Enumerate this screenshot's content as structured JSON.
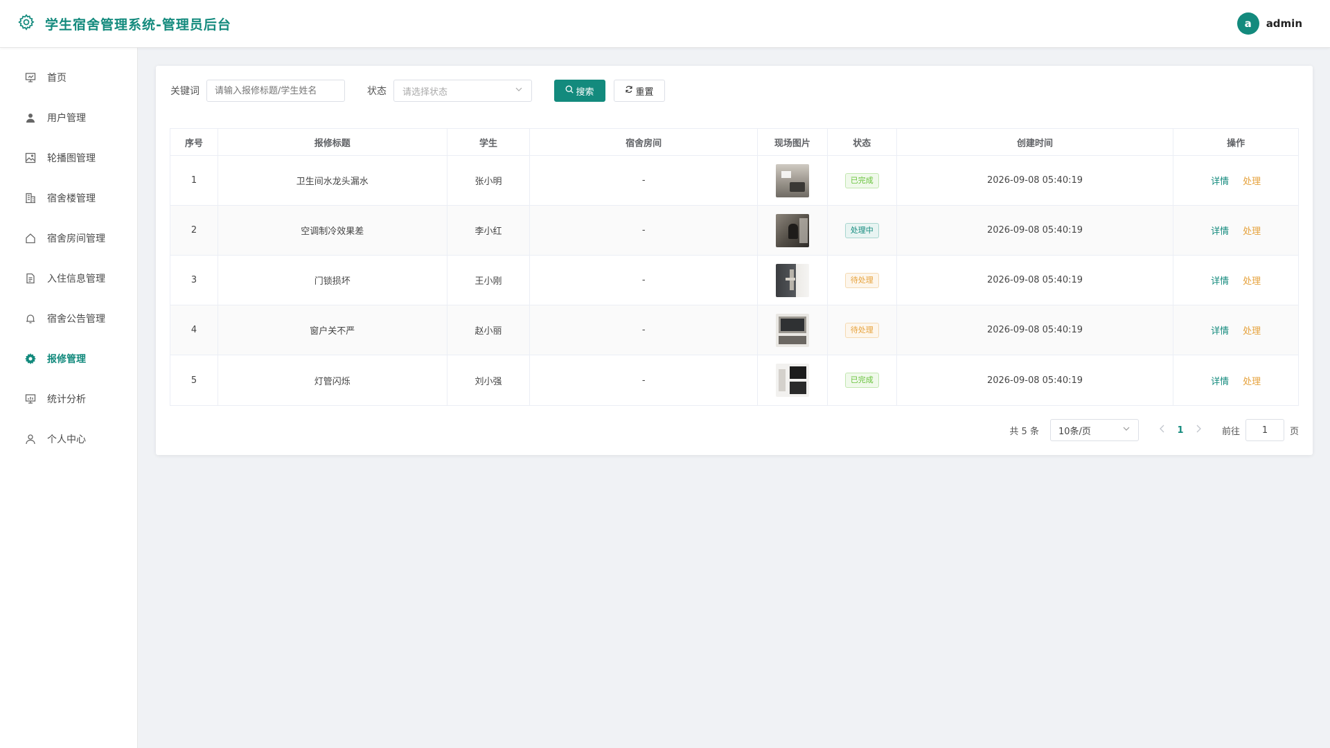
{
  "header": {
    "title": "学生宿舍管理系统-管理员后台",
    "avatar_letter": "a",
    "username": "admin"
  },
  "sidebar": {
    "items": [
      {
        "label": "首页",
        "icon": "dashboard-icon"
      },
      {
        "label": "用户管理",
        "icon": "user-icon"
      },
      {
        "label": "轮播图管理",
        "icon": "image-icon"
      },
      {
        "label": "宿舍楼管理",
        "icon": "building-icon"
      },
      {
        "label": "宿舍房间管理",
        "icon": "home-icon"
      },
      {
        "label": "入住信息管理",
        "icon": "document-icon"
      },
      {
        "label": "宿舍公告管理",
        "icon": "bell-icon"
      },
      {
        "label": "报修管理",
        "icon": "gear-icon",
        "active": true
      },
      {
        "label": "统计分析",
        "icon": "chart-icon"
      },
      {
        "label": "个人中心",
        "icon": "person-icon"
      }
    ]
  },
  "filters": {
    "keyword_label": "关键词",
    "keyword_placeholder": "请输入报修标题/学生姓名",
    "status_label": "状态",
    "status_placeholder": "请选择状态",
    "search_label": "搜索",
    "reset_label": "重置"
  },
  "table": {
    "columns": [
      "序号",
      "报修标题",
      "学生",
      "宿舍房间",
      "现场图片",
      "状态",
      "创建时间",
      "操作"
    ],
    "rows": [
      {
        "index": "1",
        "title": "卫生间水龙头漏水",
        "student": "张小明",
        "room": "-",
        "status": "已完成",
        "status_type": "done",
        "created": "2026-09-08 05:40:19"
      },
      {
        "index": "2",
        "title": "空调制冷效果差",
        "student": "李小红",
        "room": "-",
        "status": "处理中",
        "status_type": "doing",
        "created": "2026-09-08 05:40:19"
      },
      {
        "index": "3",
        "title": "门锁损坏",
        "student": "王小刚",
        "room": "-",
        "status": "待处理",
        "status_type": "todo",
        "created": "2026-09-08 05:40:19"
      },
      {
        "index": "4",
        "title": "窗户关不严",
        "student": "赵小丽",
        "room": "-",
        "status": "待处理",
        "status_type": "todo",
        "created": "2026-09-08 05:40:19"
      },
      {
        "index": "5",
        "title": "灯管闪烁",
        "student": "刘小强",
        "room": "-",
        "status": "已完成",
        "status_type": "done",
        "created": "2026-09-08 05:40:19"
      }
    ],
    "detail_label": "详情",
    "handle_label": "处理"
  },
  "pagination": {
    "total_text": "共 5 条",
    "page_size": "10条/页",
    "current_page": "1",
    "goto_label": "前往",
    "goto_value": "1",
    "page_suffix": "页"
  },
  "colors": {
    "primary": "#138a7d",
    "warning": "#e6a23c",
    "success": "#67c23a"
  }
}
